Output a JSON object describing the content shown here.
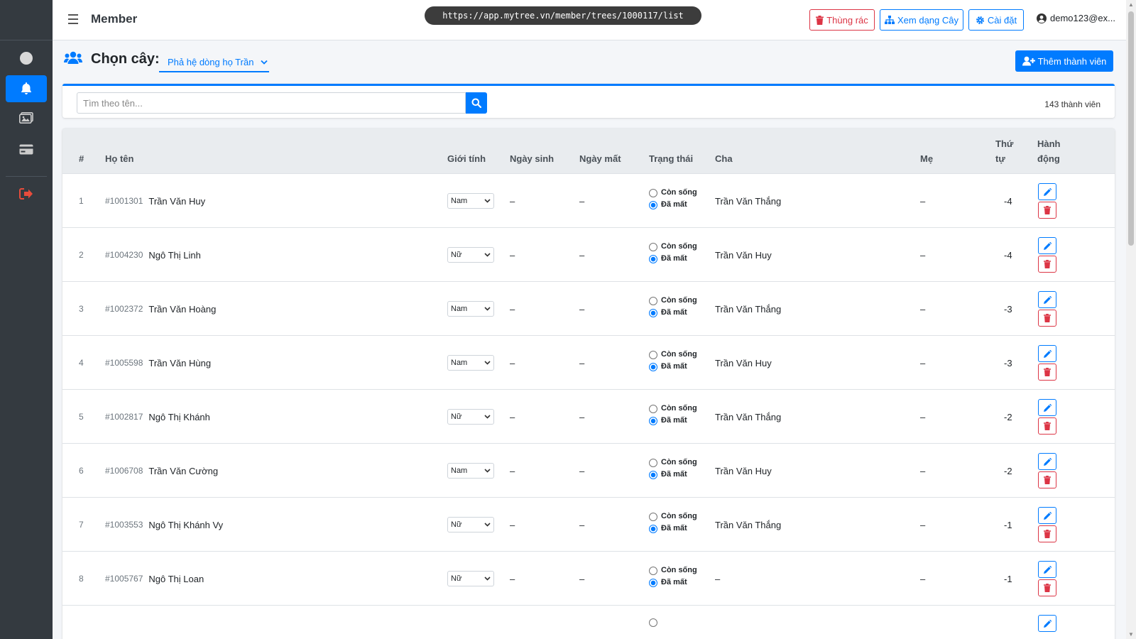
{
  "header": {
    "title": "Member",
    "url": "https://app.mytree.vn/member/trees/1000117/list",
    "trash_label": "Thùng rác",
    "tree_view_label": "Xem dạng Cây",
    "settings_label": "Cài đặt",
    "user_label": "demo123@ex..."
  },
  "subheader": {
    "choose_label": "Chọn cây:",
    "selected_tree": "Phả hệ dòng họ Trần",
    "add_member_label": "Thêm thành viên"
  },
  "search": {
    "placeholder": "Tìm theo tên...",
    "count": "143 thành viên"
  },
  "table": {
    "headers": {
      "index": "#",
      "name": "Họ tên",
      "gender": "Giới tính",
      "birth": "Ngày sinh",
      "death": "Ngày mất",
      "status": "Trạng thái",
      "father": "Cha",
      "mother": "Mẹ",
      "order_1": "Thứ",
      "order_2": "tự",
      "action_1": "Hành",
      "action_2": "động"
    },
    "status_alive": "Còn sống",
    "status_dead": "Đã mất",
    "rows": [
      {
        "index": "1",
        "id": "#1001301",
        "name": "Trần Văn Huy",
        "gender": "Nam",
        "birth": "–",
        "death": "–",
        "father": "Trần Văn Thắng",
        "mother": "–",
        "order": "-4"
      },
      {
        "index": "2",
        "id": "#1004230",
        "name": "Ngô Thị Linh",
        "gender": "Nữ",
        "birth": "–",
        "death": "–",
        "father": "Trần Văn Huy",
        "mother": "–",
        "order": "-4"
      },
      {
        "index": "3",
        "id": "#1002372",
        "name": "Trần Văn Hoàng",
        "gender": "Nam",
        "birth": "–",
        "death": "–",
        "father": "Trần Văn Thắng",
        "mother": "–",
        "order": "-3"
      },
      {
        "index": "4",
        "id": "#1005598",
        "name": "Trần Văn Hùng",
        "gender": "Nam",
        "birth": "–",
        "death": "–",
        "father": "Trần Văn Huy",
        "mother": "–",
        "order": "-3"
      },
      {
        "index": "5",
        "id": "#1002817",
        "name": "Ngô Thị Khánh",
        "gender": "Nữ",
        "birth": "–",
        "death": "–",
        "father": "Trần Văn Thắng",
        "mother": "–",
        "order": "-2"
      },
      {
        "index": "6",
        "id": "#1006708",
        "name": "Trần Văn Cường",
        "gender": "Nam",
        "birth": "–",
        "death": "–",
        "father": "Trần Văn Huy",
        "mother": "–",
        "order": "-2"
      },
      {
        "index": "7",
        "id": "#1003553",
        "name": "Ngô Thị Khánh Vy",
        "gender": "Nữ",
        "birth": "–",
        "death": "–",
        "father": "Trần Văn Thắng",
        "mother": "–",
        "order": "-1"
      },
      {
        "index": "8",
        "id": "#1005767",
        "name": "Ngô Thị Loan",
        "gender": "Nữ",
        "birth": "–",
        "death": "–",
        "father": "–",
        "mother": "–",
        "order": "-1"
      }
    ]
  },
  "colors": {
    "primary": "#007bff",
    "danger": "#dc3545",
    "sidebar": "#343a40"
  }
}
